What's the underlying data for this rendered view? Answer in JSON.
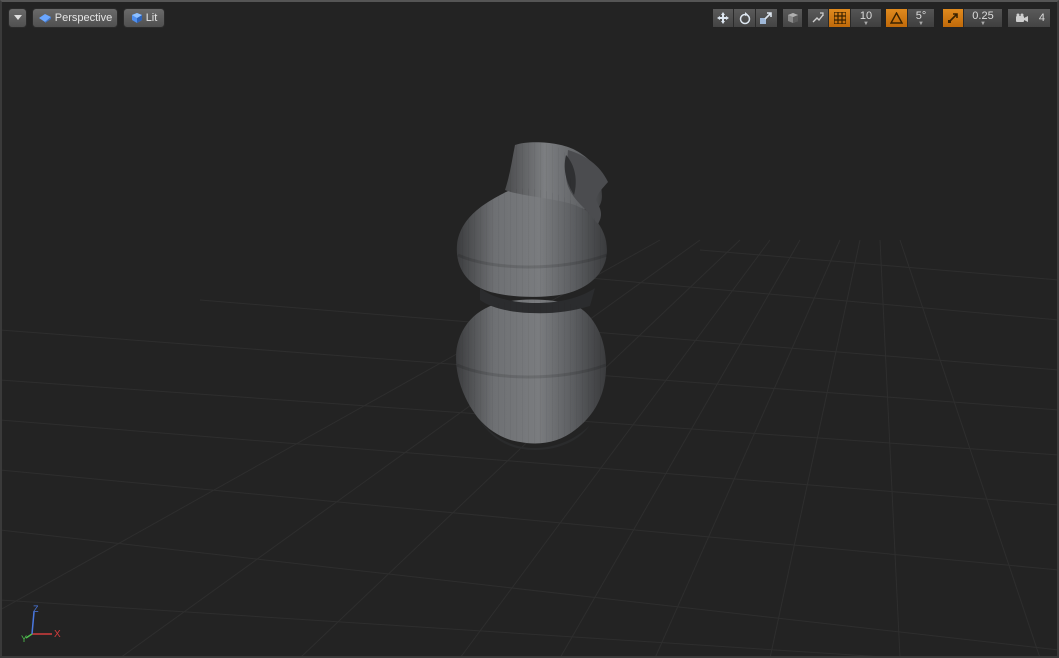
{
  "viewport": {
    "view_mode": "Perspective",
    "lighting_mode": "Lit",
    "icons": {
      "menu": "chevron-down-icon",
      "perspective": "perspective-cube-icon",
      "lit": "lit-sphere-icon",
      "translate": "translate-arrows-icon",
      "rotate": "rotate-icon",
      "scale": "scale-icon",
      "world_local": "world-local-cube-icon",
      "surface_snap": "surface-snap-icon",
      "grid_snap": "grid-snap-icon",
      "rotation_snap": "rotation-snap-icon",
      "scale_snap": "scale-snap-icon",
      "camera_speed": "camera-speed-icon"
    },
    "grid_snap_value": "10",
    "rotation_snap_value": "5°",
    "scale_snap_value": "0.25",
    "camera_speed_value": "4",
    "axis_labels": {
      "x": "X",
      "y": "Y",
      "z": "Z"
    },
    "colors": {
      "background": "#232323",
      "grid": "#2d2d2d",
      "accent_orange": "#d57a12",
      "axis_x": "#d23c3c",
      "axis_y": "#4ec04e",
      "axis_z": "#4a78e0"
    }
  }
}
